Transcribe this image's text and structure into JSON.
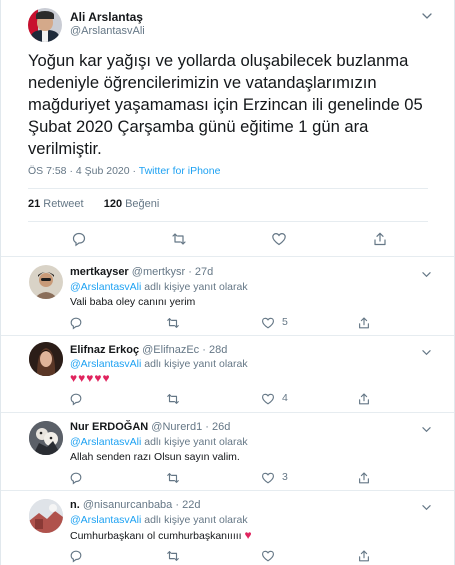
{
  "tweet": {
    "name": "Ali Arslantaş",
    "handle": "@ArslantasvAli",
    "text": "Yoğun kar yağışı ve yollarda oluşabilecek buzlanma nedeniyle öğrencilerimizin ve vatandaşlarımızın mağduriyet yaşamaması için Erzincan ili genelinde 05 Şubat 2020 Çarşamba günü eğitime 1 gün ara verilmiştir.",
    "time": "ÖS 7:58",
    "date": "4 Şub 2020",
    "separator": "·",
    "source": "Twitter for iPhone",
    "retweets": "21",
    "retweets_label": "Retweet",
    "likes": "120",
    "likes_label": "Beğeni"
  },
  "replies": [
    {
      "name": "mertkayser",
      "handle": "@mertkysr",
      "age": "· 27d",
      "mention": "@ArslantasvAli",
      "reply_suffix": "adlı kişiye yanıt olarak",
      "text": "Vali baba oley canını yerim",
      "likes": "5",
      "avatar_color": "#d9d3c7"
    },
    {
      "name": "Elifnaz Erkoç",
      "handle": "@ElifnazEc",
      "age": "· 28d",
      "mention": "@ArslantasvAli",
      "reply_suffix": "adlı kişiye yanıt olarak",
      "text": "♥♥♥♥♥",
      "likes": "4",
      "avatar_color": "#3a2a22"
    },
    {
      "name": "Nur ERDOĞAN",
      "handle": "@Nurerd1",
      "age": "· 26d",
      "mention": "@ArslantasvAli",
      "reply_suffix": "adlı kişiye yanıt olarak",
      "text": "Allah senden razı Olsun sayın valim.",
      "likes": "3",
      "avatar_color": "#4a4f57"
    },
    {
      "name": "n.",
      "handle": "@nisanurcanbaba",
      "age": "· 22d",
      "mention": "@ArslantasvAli",
      "reply_suffix": "adlı kişiye yanıt olarak",
      "text": "Cumhurbaşkanı ol cumhurbaşkanııııı",
      "heart": "♥",
      "likes": "",
      "avatar_color": "#c7cdd6"
    }
  ],
  "colors": {
    "link": "#1da1f2",
    "muted": "#657786",
    "text": "#14171a",
    "heart": "#e0245e",
    "divider": "#e6ecf0"
  },
  "icons": [
    "chevron-down-icon",
    "reply-icon",
    "retweet-icon",
    "like-icon",
    "share-icon"
  ]
}
